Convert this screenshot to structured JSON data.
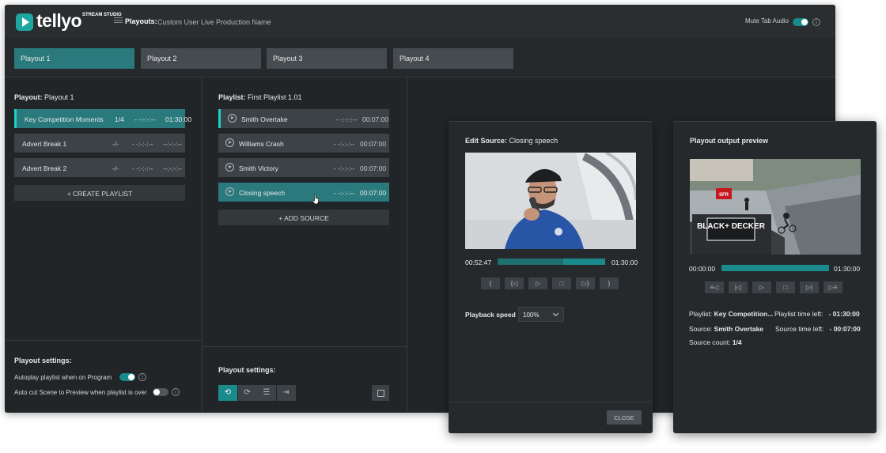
{
  "app": {
    "logo_text": "tellyo",
    "logo_sub": "STREAM STUDIO",
    "playouts_label": "Playouts:",
    "production_name": "Custom User Live Production Name",
    "mute_label": "Mute Tab Audio",
    "info_glyph": "i"
  },
  "tabs": [
    {
      "label": "Playout 1"
    },
    {
      "label": "Playout 2"
    },
    {
      "label": "Playout 3"
    },
    {
      "label": "Playout 4"
    }
  ],
  "playout": {
    "title_key": "Playout:",
    "title_val": "Playout 1",
    "items": [
      {
        "name": "Key Competition Moments",
        "count": "1/4",
        "time_left": "- -:-:-:--",
        "duration": "01:30:00"
      },
      {
        "name": "Advert Break 1",
        "count": "-/-",
        "time_left": "- -:-:-:--",
        "duration": "--:-:-:--"
      },
      {
        "name": "Advert Break 2",
        "count": "-/-",
        "time_left": "- -:-:-:--",
        "duration": "--:-:-:--"
      }
    ],
    "create_label": "+  CREATE PLAYLIST",
    "settings_title": "Playout settings:",
    "autoplay_label": "Autoplay playlist when on Program",
    "autocut_label": "Auto cut Scene to Preview when playlist is over"
  },
  "playlist": {
    "title_key": "Playlist:",
    "title_val": "First Playlist 1.01",
    "items": [
      {
        "name": "Smith Overtake",
        "time_left": "- -:-:-:--",
        "duration": "00:07:00"
      },
      {
        "name": "Williams Crash",
        "time_left": "- -:-:-:--",
        "duration": "00:07:00"
      },
      {
        "name": "Smith Victory",
        "time_left": "- -:-:-:--",
        "duration": "00:07:00"
      },
      {
        "name": "Closing speech",
        "time_left": "- -:-:-:--",
        "duration": "00:07:00"
      }
    ],
    "add_label": "+  ADD SOURCE",
    "settings_title": "Playout settings:"
  },
  "edit_source": {
    "title_key": "Edit Source:",
    "title_val": "Closing speech",
    "current_time": "00:52:47",
    "end_time": "01:30:00",
    "progress": 0.61,
    "speed_label": "Playback speed",
    "speed_value": "100%",
    "close_label": "CLOSE"
  },
  "preview": {
    "title": "Playout output preview",
    "current_time": "00:00:00",
    "end_time": "01:30:00",
    "playlist_key": "Playlist:",
    "playlist_val": "Key Competition...",
    "playlist_time_key": "Playlist time left:",
    "playlist_time_val": "- 01:30:00",
    "source_key": "Source:",
    "source_val": "Smith Overtake",
    "source_time_key": "Source time left:",
    "source_time_val": "- 00:07:00",
    "count_key": "Source count:",
    "count_val": "1/4",
    "banner_text": "BLACK+ DECKER",
    "sfr_text": "SFR"
  }
}
